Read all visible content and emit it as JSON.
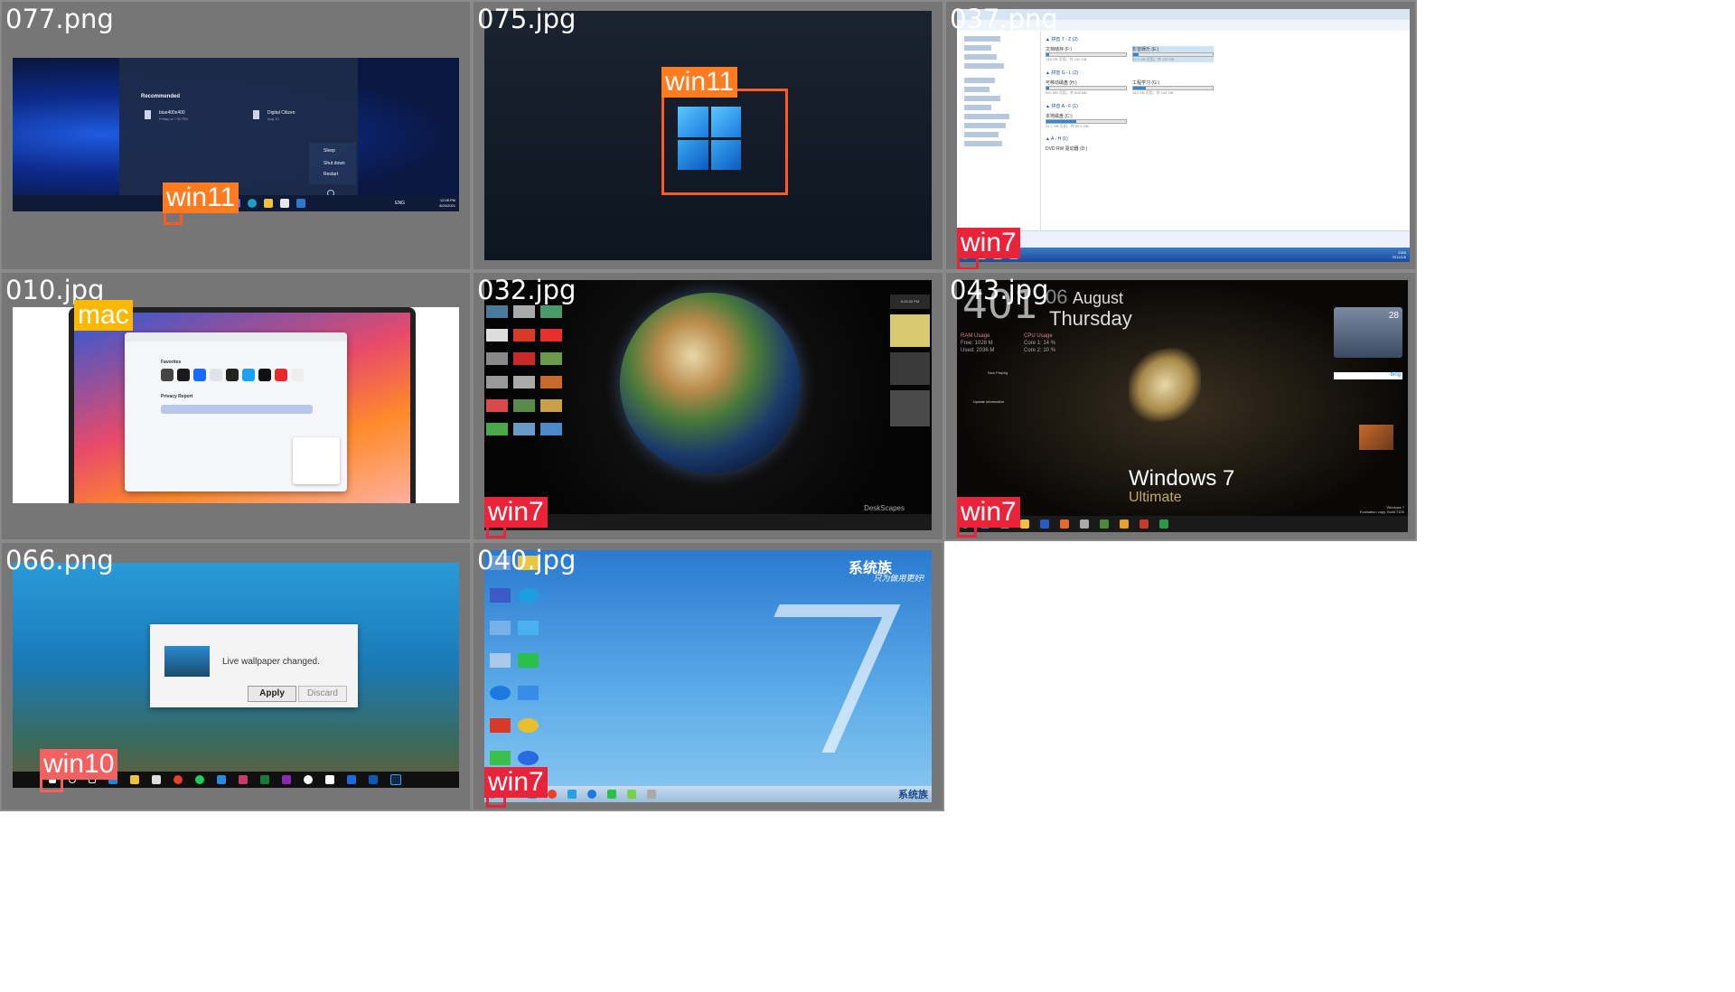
{
  "cells": [
    {
      "file": "077.png",
      "tag": "win11"
    },
    {
      "file": "075.jpg",
      "tag": "win11"
    },
    {
      "file": "037.png",
      "tag": "win7"
    },
    {
      "file": "010.jpg",
      "tag": "mac"
    },
    {
      "file": "032.jpg",
      "tag": "win7"
    },
    {
      "file": "043.jpg",
      "tag": "win7"
    },
    {
      "file": "066.png",
      "tag": "win10"
    },
    {
      "file": "040.jpg",
      "tag": "win7"
    }
  ],
  "w11start": {
    "recommended": "Recommended",
    "item1_name": "blue400x400",
    "item1_sub": "Friday at 7:30 PM",
    "item2_name": "Digital Citizen",
    "item2_sub": "Aug 10",
    "sleep": "Sleep",
    "shutdown": "Shut down",
    "restart": "Restart",
    "tray_lang": "ENG",
    "tray_time": "12:08 PM",
    "tray_date": "8/20/2021"
  },
  "mac": {
    "favorites": "Favorites",
    "privacy": "Privacy Report"
  },
  "w7ultimate": {
    "day_num": "06",
    "month": "August",
    "weekday": "Thursday",
    "year_digits": "401",
    "logo_text": "Windows 7",
    "edition": "Ultimate",
    "ram_label": "RAM Usage",
    "ram_free": "Free: 1028 M",
    "ram_used": "Used: 2036 M",
    "cpu_label": "CPU Usage",
    "cpu_core1": "Core 1: 14 %",
    "cpu_core2": "Core 2: 10 %",
    "temp": "28",
    "now_playing": "Now Playing",
    "update_info": "Update Information",
    "bing": "bing",
    "build1": "Windows 7",
    "build2": "Evaluation copy. Build 7100"
  },
  "w10dialog": {
    "message": "Live wallpaper changed.",
    "apply": "Apply",
    "discard": "Discard"
  },
  "xtz": {
    "brand": "系统族",
    "slogan": "只为做用更好!",
    "tray_brand": "系统族"
  },
  "desk032": {
    "watermark": "DeskScapes",
    "clock": "6:26:32 PM"
  },
  "explorer": {
    "grp1": "▲ 拼音 T - Z (2)",
    "grp2": "▲ 拼音 G - L (2)",
    "grp3": "▲ 拼音 A - F (1)",
    "grp4": "▲ A - H (1)",
    "drive1": "文档储存 (F:)",
    "drive2": "影音娱乐 (E:)",
    "drive3": "可移动磁盘 (H:)",
    "drive4": "工程学习 (G:)",
    "drive5": "本地磁盘 (C:)",
    "drive6": "DVD RW 驱动器 (D:)",
    "sz1": "146 GB 可用，共 150 GB",
    "sz2": "93.3 GB 可用，共 100 GB",
    "sz3": "592 MB 可用，共 608 MB",
    "sz4": "163 GB 可用，共 194 GB",
    "sz5": "31.7 GB 可用，共 50.0 GB",
    "time": "2345",
    "date": "2011/1/6"
  }
}
